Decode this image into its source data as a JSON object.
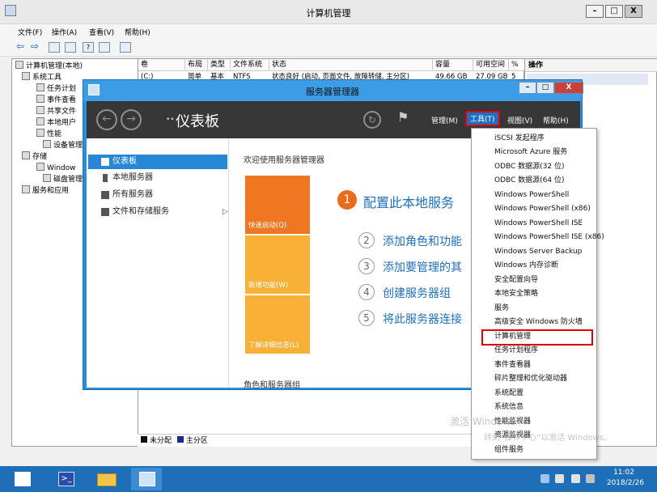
{
  "cm": {
    "title": "计算机管理",
    "minimize": "–",
    "maximize": "□",
    "close": "X",
    "menu": [
      "文件(F)",
      "操作(A)",
      "查看(V)",
      "帮助(H)"
    ],
    "tree": [
      "计算机管理(本地)",
      "系统工具",
      "任务计划",
      "事件查看",
      "共享文件",
      "本地用户",
      "性能",
      "设备管理",
      "存储",
      "Window",
      "磁盘管理",
      "服务和应用"
    ],
    "columns": [
      "卷",
      "布局",
      "类型",
      "文件系统",
      "状态",
      "容量",
      "可用空间",
      "%"
    ],
    "row1": [
      "(C:)",
      "简单",
      "基本",
      "NTFS",
      "状态良好 (启动, 页面文件, 故障转储, 主分区)",
      "49.66 GB",
      "27.09 GB",
      "5"
    ],
    "actions_head": "操作",
    "legend_unalloc": "未分配",
    "legend_primary": "主分区"
  },
  "sm": {
    "title": "服务器管理器",
    "minimize": "–",
    "maximize": "□",
    "close": "X",
    "prefix": "••",
    "dashboard_title": "仪表板",
    "back": "←",
    "forward": "→",
    "refresh": "↻",
    "flag": "⚑",
    "menu_manage": "管理(M)",
    "menu_tools": "工具(T)",
    "menu_view": "视图(V)",
    "menu_help": "帮助(H)",
    "nav": [
      "仪表板",
      "本地服务器",
      "所有服务器",
      "文件和存储服务"
    ],
    "nav_arrow": "▷",
    "welcome": "欢迎使用服务器管理器",
    "tiles": [
      "快速启动(Q)",
      "新增功能(W)",
      "了解详细信息(L)"
    ],
    "steps": [
      {
        "num": "1",
        "text": "配置此本地服务"
      },
      {
        "num": "2",
        "text": "添加角色和功能"
      },
      {
        "num": "3",
        "text": "添加要管理的其"
      },
      {
        "num": "4",
        "text": "创建服务器组"
      },
      {
        "num": "5",
        "text": "将此服务器连接"
      }
    ],
    "roles_title": "角色和服务器组"
  },
  "tools_menu": [
    "iSCSI 发起程序",
    "Microsoft Azure 服务",
    "ODBC 数据源(32 位)",
    "ODBC 数据源(64 位)",
    "Windows PowerShell",
    "Windows PowerShell (x86)",
    "Windows PowerShell ISE",
    "Windows PowerShell ISE (x86)",
    "Windows Server Backup",
    "Windows 内存诊断",
    "安全配置向导",
    "本地安全策略",
    "服务",
    "高级安全 Windows 防火墙",
    "计算机管理",
    "任务计划程序",
    "事件查看器",
    "碎片整理和优化驱动器",
    "系统配置",
    "系统信息",
    "性能监视器",
    "资源监视器",
    "组件服务"
  ],
  "watermark": {
    "line1": "激活 Windows",
    "line2": "转到“操作中心”以激活 Windows。"
  },
  "taskbar": {
    "ps_glyph": ">_",
    "time": "11:02",
    "date": "2018/2/26"
  }
}
